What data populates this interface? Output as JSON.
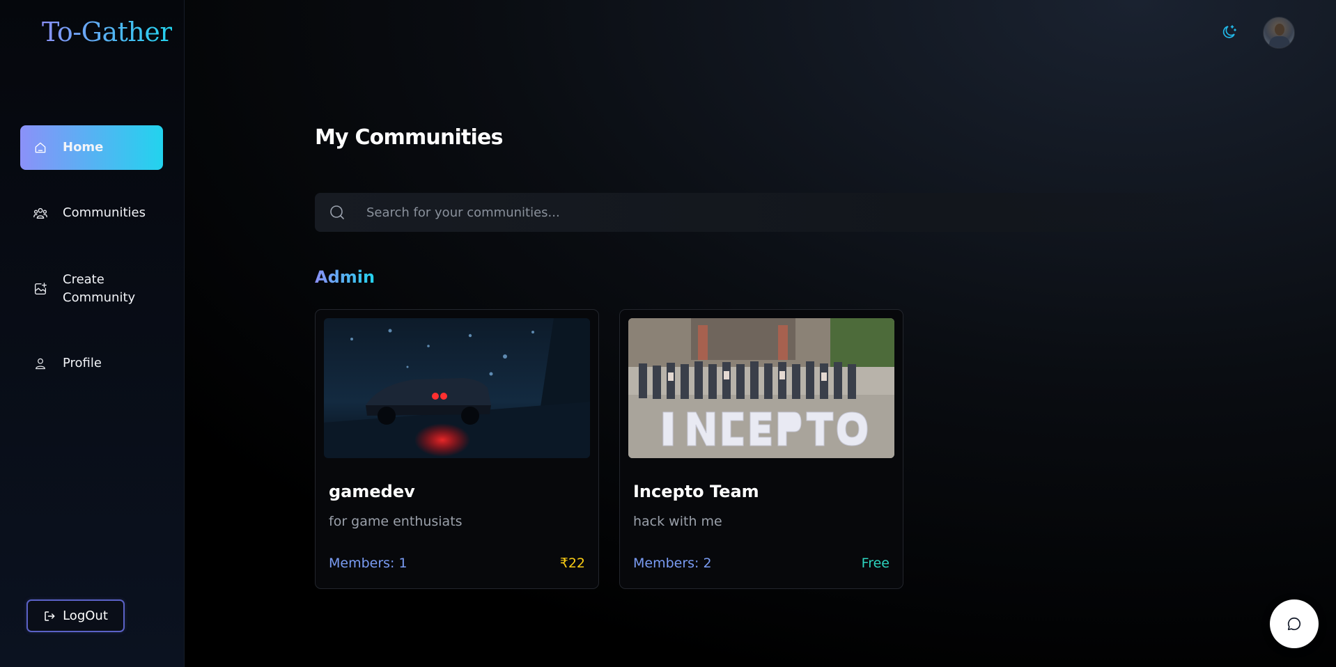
{
  "app": {
    "logo": "To-Gather"
  },
  "sidebar": {
    "items": [
      {
        "label": "Home",
        "icon": "home-icon",
        "active": true
      },
      {
        "label": "Communities",
        "icon": "users-icon",
        "active": false
      },
      {
        "label": "Create\nCommunity",
        "icon": "create-community-icon",
        "active": false
      },
      {
        "label": "Profile",
        "icon": "user-icon",
        "active": false
      }
    ],
    "logout_label": "LogOut"
  },
  "header": {
    "theme_icon": "moon-stars-icon",
    "avatar_icon": "avatar"
  },
  "main": {
    "title": "My Communities",
    "search": {
      "placeholder": "Search for your communities...",
      "value": ""
    },
    "section_title": "Admin",
    "communities": [
      {
        "name": "gamedev",
        "description": "for game enthusiats",
        "members": "Members: 1",
        "price": "₹22",
        "price_color": "#facc15",
        "image": "dark-rainy-street-sports-car"
      },
      {
        "name": "Incepto Team",
        "description": "hack with me",
        "members": "Members: 2",
        "price": "Free",
        "price_color": "#2dd4bf",
        "image": "team-group-photo-incepto"
      }
    ]
  },
  "chat": {
    "icon": "chat-bubble-icon"
  },
  "colors": {
    "accent_start": "#8b91f8",
    "accent_end": "#22d3ee",
    "members_text": "#7a9cf3",
    "background": "#000000"
  }
}
